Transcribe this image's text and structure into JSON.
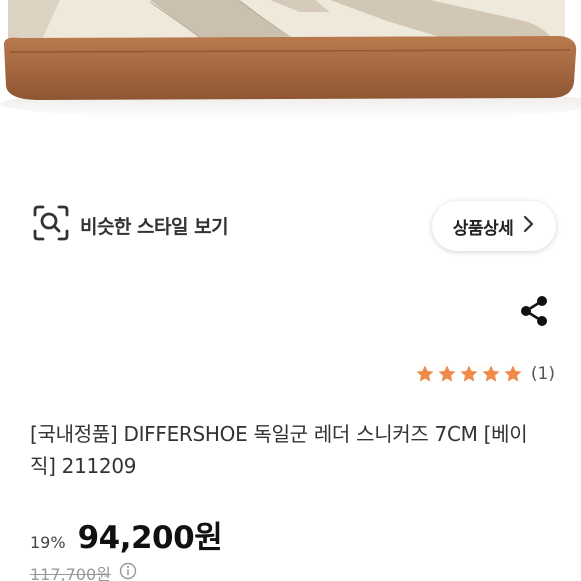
{
  "similar": {
    "label": "비슷한 스타일 보기",
    "icon": "visual-search-icon"
  },
  "detail": {
    "label": "상품상세",
    "icon": "chevron-right-icon"
  },
  "share": {
    "icon": "share-icon"
  },
  "rating": {
    "stars": 5,
    "max": 5,
    "count": "(1)",
    "color": "#f08a4b"
  },
  "product": {
    "title": "[국내정품] DIFFERSHOE 독일군 레더 스니커즈 7CM [베이직] 211209"
  },
  "price": {
    "discount": "19%",
    "current": "94,200원",
    "original": "117,700원",
    "info_icon": "info-icon"
  }
}
